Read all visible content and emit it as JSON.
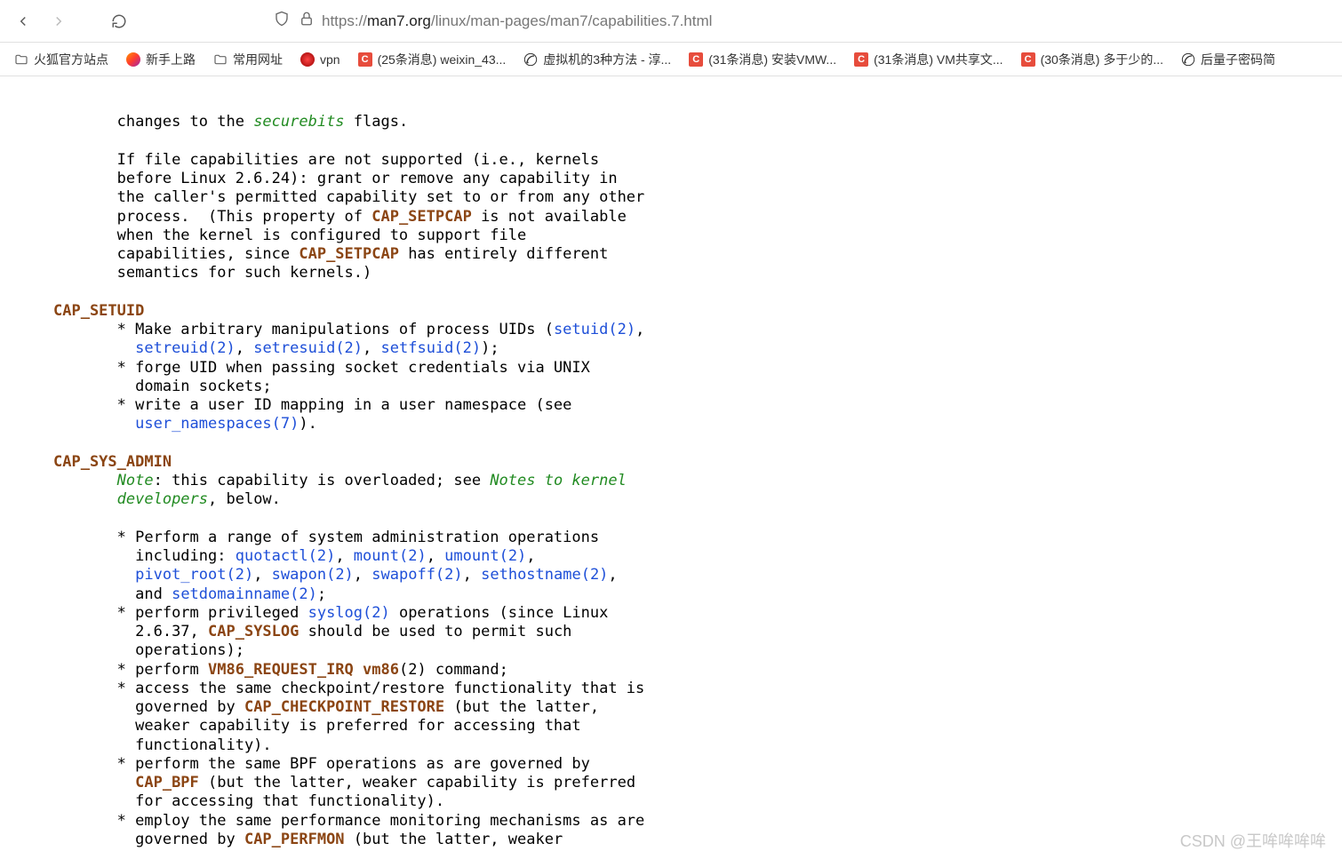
{
  "url": {
    "scheme": "https://",
    "domain": "man7.org",
    "path": "/linux/man-pages/man7/capabilities.7.html"
  },
  "bookmarks": [
    {
      "type": "folder",
      "label": "火狐官方站点"
    },
    {
      "type": "firefox",
      "label": "新手上路"
    },
    {
      "type": "folder",
      "label": "常用网址"
    },
    {
      "type": "vpn",
      "label": "vpn"
    },
    {
      "type": "c",
      "label": "(25条消息) weixin_43..."
    },
    {
      "type": "cnb",
      "label": "虚拟机的3种方法 - 淳..."
    },
    {
      "type": "c",
      "label": "(31条消息) 安装VMW..."
    },
    {
      "type": "c",
      "label": "(31条消息) VM共享文..."
    },
    {
      "type": "c",
      "label": "(30条消息) 多于少的..."
    },
    {
      "type": "cnb",
      "label": "后量子密码简"
    }
  ],
  "page": {
    "p1_pre": "       changes to the ",
    "p1_kw": "securebits",
    "p1_post": " flags.",
    "p2_a": "       If file capabilities are not supported (i.e., kernels",
    "p2_b": "       before Linux 2.6.24): grant or remove any capability in",
    "p2_c": "       the caller's permitted capability set to or from any other",
    "p2_d_pre": "       process.  (This property of ",
    "p2_d_kw": "CAP_SETPCAP",
    "p2_d_post": " is not available",
    "p2_e": "       when the kernel is configured to support file",
    "p2_f_pre": "       capabilities, since ",
    "p2_f_kw": "CAP_SETPCAP",
    "p2_f_post": " has entirely different",
    "p2_g": "       semantics for such kernels.)",
    "h1": "CAP_SETUID",
    "s1_a_pre": "       * Make arbitrary manipulations of process UIDs (",
    "s1_a_l1": "setuid(2)",
    "s1_a_mid1": ",",
    "s1_b_pre": "         ",
    "s1_b_l1": "setreuid(2)",
    "s1_b_mid1": ", ",
    "s1_b_l2": "setresuid(2)",
    "s1_b_mid2": ", ",
    "s1_b_l3": "setfsuid(2)",
    "s1_b_post": ");",
    "s1_c": "       * forge UID when passing socket credentials via UNIX",
    "s1_d": "         domain sockets;",
    "s1_e": "       * write a user ID mapping in a user namespace (see",
    "s1_f_pre": "         ",
    "s1_f_l1": "user_namespaces(7)",
    "s1_f_post": ").",
    "h2": "CAP_SYS_ADMIN",
    "s2_a_pre": "       ",
    "s2_a_note": "Note",
    "s2_a_mid": ": this capability is overloaded; see ",
    "s2_a_it": "Notes to kernel",
    "s2_b_pre": "       ",
    "s2_b_it": "developers",
    "s2_b_post": ", below.",
    "s2_c": "       * Perform a range of system administration operations",
    "s2_d_pre": "         including: ",
    "s2_d_l1": "quotactl(2)",
    "s2_d_m1": ", ",
    "s2_d_l2": "mount(2)",
    "s2_d_m2": ", ",
    "s2_d_l3": "umount(2)",
    "s2_d_post": ",",
    "s2_e_pre": "         ",
    "s2_e_l1": "pivot_root(2)",
    "s2_e_m1": ", ",
    "s2_e_l2": "swapon(2)",
    "s2_e_m2": ", ",
    "s2_e_l3": "swapoff(2)",
    "s2_e_m3": ", ",
    "s2_e_l4": "sethostname(2)",
    "s2_e_post": ",",
    "s2_f_pre": "         and ",
    "s2_f_l1": "setdomainname(2)",
    "s2_f_post": ";",
    "s2_g_pre": "       * perform privileged ",
    "s2_g_l1": "syslog(2)",
    "s2_g_post": " operations (since Linux",
    "s2_h_pre": "         2.6.37, ",
    "s2_h_kw": "CAP_SYSLOG",
    "s2_h_post": " should be used to permit such",
    "s2_i": "         operations);",
    "s2_j_pre": "       * perform ",
    "s2_j_kw1": "VM86_REQUEST_IRQ",
    "s2_j_mid": " ",
    "s2_j_kw2": "vm86",
    "s2_j_post": "(2) command;",
    "s2_k": "       * access the same checkpoint/restore functionality that is",
    "s2_l_pre": "         governed by ",
    "s2_l_kw": "CAP_CHECKPOINT_RESTORE",
    "s2_l_post": " (but the latter,",
    "s2_m": "         weaker capability is preferred for accessing that",
    "s2_n": "         functionality).",
    "s2_o": "       * perform the same BPF operations as are governed by",
    "s2_p_pre": "         ",
    "s2_p_kw": "CAP_BPF",
    "s2_p_post": " (but the latter, weaker capability is preferred",
    "s2_q": "         for accessing that functionality).",
    "s2_r": "       * employ the same performance monitoring mechanisms as are",
    "s2_s_pre": "         governed by ",
    "s2_s_kw": "CAP_PERFMON",
    "s2_s_post": " (but the latter, weaker"
  },
  "watermark": "CSDN @王哞哞哞哞"
}
